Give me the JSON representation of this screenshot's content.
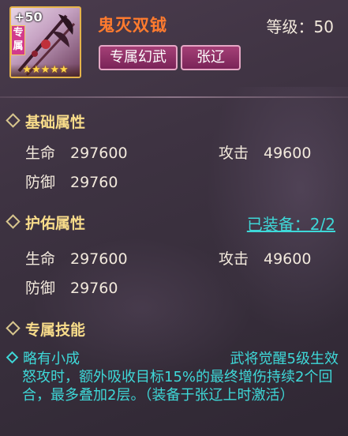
{
  "header": {
    "card_plus": "+50",
    "exclusive_badge": "专属",
    "stars": "★★★★★",
    "weapon_name": "鬼灭双钺",
    "level_text": "等级：50",
    "tags": [
      "专属幻武",
      "张辽"
    ]
  },
  "colors": {
    "weapon_name": "#ff7b2e",
    "section_title": "#f8dc8a",
    "accent_cyan": "#3ed8d8",
    "tag_bg": "#8c2f66"
  },
  "base_attrs": {
    "title": "基础属性",
    "hp_label": "生命",
    "hp_value": "297600",
    "atk_label": "攻击",
    "atk_value": "49600",
    "def_label": "防御",
    "def_value": "29760"
  },
  "protect_attrs": {
    "title": "护佑属性",
    "equipped": "已装备：2/2",
    "hp_label": "生命",
    "hp_value": "297600",
    "atk_label": "攻击",
    "atk_value": "49600",
    "def_label": "防御",
    "def_value": "29760"
  },
  "skill": {
    "title": "专属技能",
    "name": "略有小成",
    "condition": "武将觉醒5级生效",
    "description": "怒攻时，额外吸收目标15%的最终增伤持续2个回合，最多叠加2层。（装备于张辽上时激活）"
  }
}
